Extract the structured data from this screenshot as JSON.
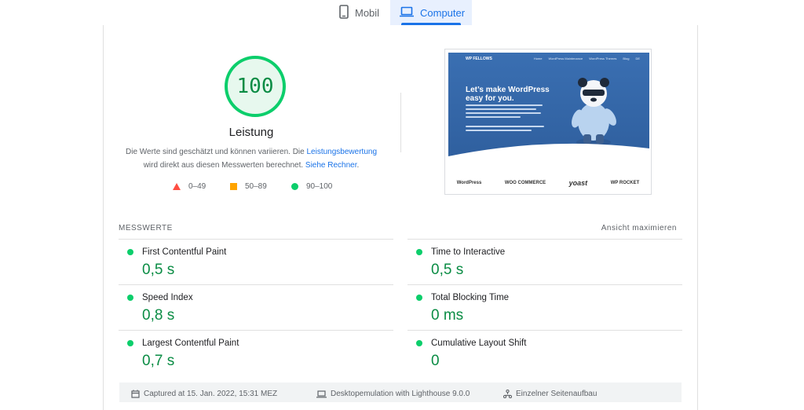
{
  "tabs": {
    "mobile": "Mobil",
    "computer": "Computer"
  },
  "score": {
    "value": "100",
    "title": "Leistung",
    "desc_part1": "Die Werte sind geschätzt und können variieren. Die ",
    "desc_link1": "Leistungsbewertung",
    "desc_part2": "wird direkt aus diesen Messwerten berechnet. ",
    "desc_link2": "Siehe Rechner",
    "desc_end": "."
  },
  "legend": {
    "fail": "0–49",
    "average": "50–89",
    "pass": "90–100"
  },
  "preview": {
    "logo": "WP FELLOWS",
    "nav": [
      "Home",
      "WordPress Maintenance",
      "WordPress Themes",
      "Blog",
      "DE"
    ],
    "headline": "Let’s make WordPress easy for you.",
    "partners": [
      "WordPress",
      "WOO COMMERCE",
      "yoast",
      "WP ROCKET"
    ]
  },
  "metrics": {
    "section_title": "MESSWERTE",
    "toggle": "Ansicht maximieren",
    "items": [
      {
        "label": "First Contentful Paint",
        "value": "0,5 s"
      },
      {
        "label": "Time to Interactive",
        "value": "0,5 s"
      },
      {
        "label": "Speed Index",
        "value": "0,8 s"
      },
      {
        "label": "Total Blocking Time",
        "value": "0 ms"
      },
      {
        "label": "Largest Contentful Paint",
        "value": "0,7 s"
      },
      {
        "label": "Cumulative Layout Shift",
        "value": "0"
      }
    ]
  },
  "footer": {
    "captured": "Captured at 15. Jan. 2022, 15:31 MEZ",
    "emulation": "Desktopemulation with Lighthouse 9.0.0",
    "load": "Einzelner Seitenaufbau"
  },
  "colors": {
    "pass": "#0cce6b",
    "average": "#ffa400",
    "fail": "#ff4e42",
    "accent": "#1a73e8"
  }
}
